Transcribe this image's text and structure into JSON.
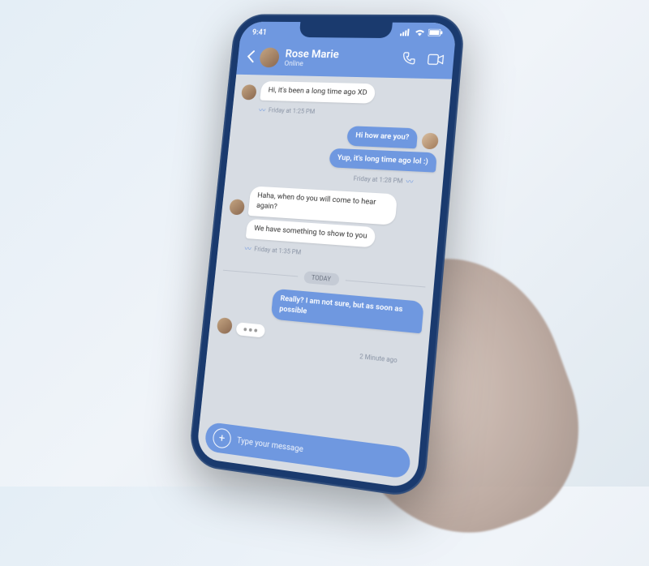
{
  "status": {
    "time": "9:41",
    "signal": "••••",
    "wifi": "wifi",
    "battery": "batt"
  },
  "header": {
    "contact_name": "Rose Marie",
    "status": "Online"
  },
  "messages": {
    "m0": "Hi, it's been a long time ago XD",
    "t0": "Friday at 1:25 PM",
    "m1": "Hi how are you?",
    "m2": "Yup, it's long time ago lol :)",
    "t1": "Friday at 1:28 PM",
    "m3": "Haha, when do you will come to hear again?",
    "m4": "We have something to show to you",
    "t2": "Friday at 1:35 PM",
    "divider": "TODAY",
    "m5": "Really? I am not sure, but as soon as possible",
    "t3": "2 Minute ago"
  },
  "input": {
    "placeholder": "Type your message"
  }
}
